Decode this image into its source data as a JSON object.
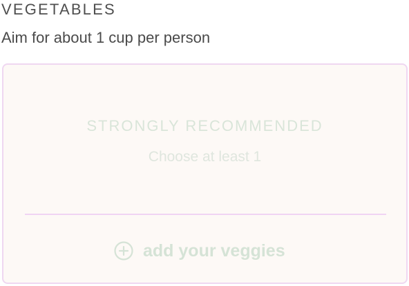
{
  "section": {
    "title": "VEGETABLES",
    "subtitle": "Aim for about 1 cup per person"
  },
  "card": {
    "heading": "STRONGLY RECOMMENDED",
    "hint": "Choose at least 1",
    "add_label": "add your veggies",
    "add_icon": "plus-circle-icon"
  },
  "colors": {
    "card_border": "#efd7f1",
    "card_bg": "#fdf9f6",
    "muted_green": "#d5e3d6",
    "title_text": "#4f4f4f"
  }
}
